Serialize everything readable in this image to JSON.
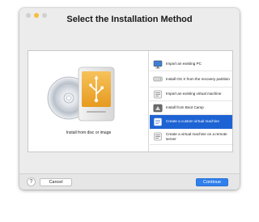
{
  "window": {
    "title": "Select the Installation Method"
  },
  "left_pane": {
    "caption": "Install from disc or image"
  },
  "options": [
    {
      "label": "Import an existing PC",
      "icon": "pc-monitor-icon"
    },
    {
      "label": "Install OS X from the recovery partition",
      "icon": "recovery-drive-icon"
    },
    {
      "label": "Import an existing virtual machine",
      "icon": "virtual-machine-icon"
    },
    {
      "label": "Install from Boot Camp",
      "icon": "boot-camp-icon"
    },
    {
      "label": "Create a custom virtual machine",
      "icon": "custom-vm-icon",
      "selected": true
    },
    {
      "label": "Create a virtual machine on a remote server",
      "icon": "remote-server-icon"
    }
  ],
  "footer": {
    "help_label": "?",
    "cancel_label": "Cancel",
    "continue_label": "Continue"
  },
  "colors": {
    "selection": "#1e63d4",
    "continue_button": "#2f80ed",
    "minimize_dot": "#f4bf40"
  }
}
